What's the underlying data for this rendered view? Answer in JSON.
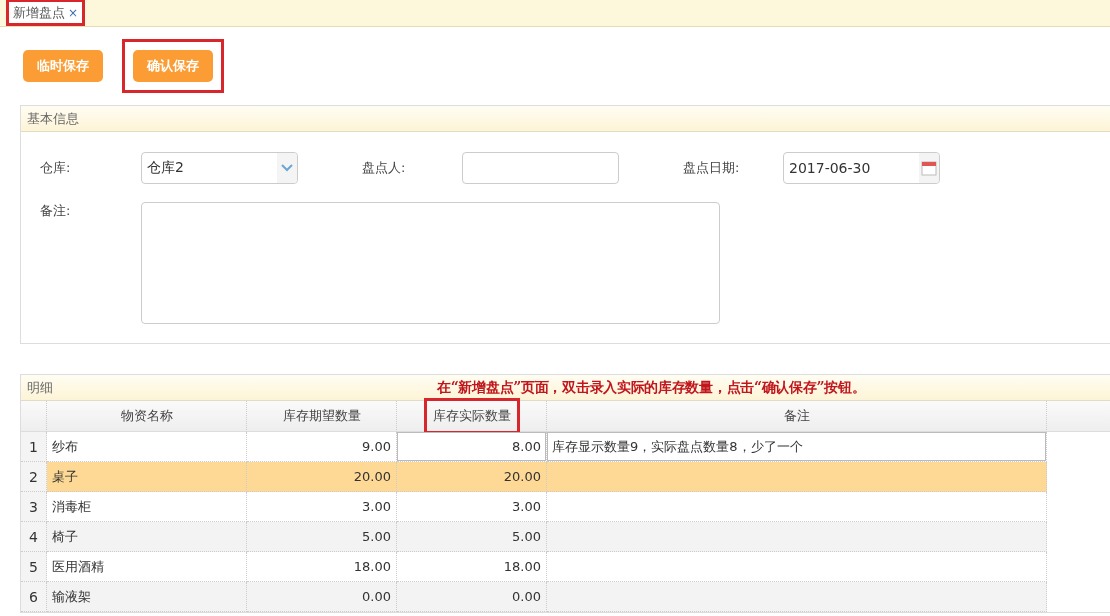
{
  "tabs": [
    {
      "label": "新增盘点",
      "close": "×",
      "selected": true,
      "highlighted": true
    }
  ],
  "buttons": [
    {
      "label": "临时保存",
      "highlighted": false
    },
    {
      "label": "确认保存",
      "highlighted": true
    }
  ],
  "basic_info": {
    "title": "基本信息",
    "warehouse": {
      "label": "仓库:",
      "value": "仓库2"
    },
    "counter": {
      "label": "盘点人:"
    },
    "date": {
      "label": "盘点日期:",
      "value": "2017-06-30"
    },
    "remark": {
      "label": "备注:"
    }
  },
  "details": {
    "title": "明细",
    "note": "在“新增盘点”页面，双击录入实际的库存数量，点击“确认保存”按钮。",
    "columns": [
      {
        "label": "物资名称",
        "highlighted": false
      },
      {
        "label": "库存期望数量",
        "highlighted": false
      },
      {
        "label": "库存实际数量",
        "highlighted": true
      },
      {
        "label": "备注",
        "highlighted": false
      }
    ],
    "rows": [
      {
        "index": "1",
        "name": "纱布",
        "expected": "9.00",
        "actual": "8.00",
        "remark": "库存显示数量9，实际盘点数量8，少了一个",
        "selected": false,
        "editing": true
      },
      {
        "index": "2",
        "name": "桌子",
        "expected": "20.00",
        "actual": "20.00",
        "selected": true,
        "editing": false
      },
      {
        "index": "3",
        "name": "消毒柜",
        "expected": "3.00",
        "actual": "3.00",
        "selected": false,
        "editing": false
      },
      {
        "index": "4",
        "name": "椅子",
        "expected": "5.00",
        "actual": "5.00",
        "selected": false,
        "editing": false
      },
      {
        "index": "5",
        "name": "医用酒精",
        "expected": "18.00",
        "actual": "18.00",
        "selected": false,
        "editing": false
      },
      {
        "index": "6",
        "name": "输液架",
        "expected": "0.00",
        "actual": "0.00",
        "selected": false,
        "editing": false
      }
    ]
  }
}
